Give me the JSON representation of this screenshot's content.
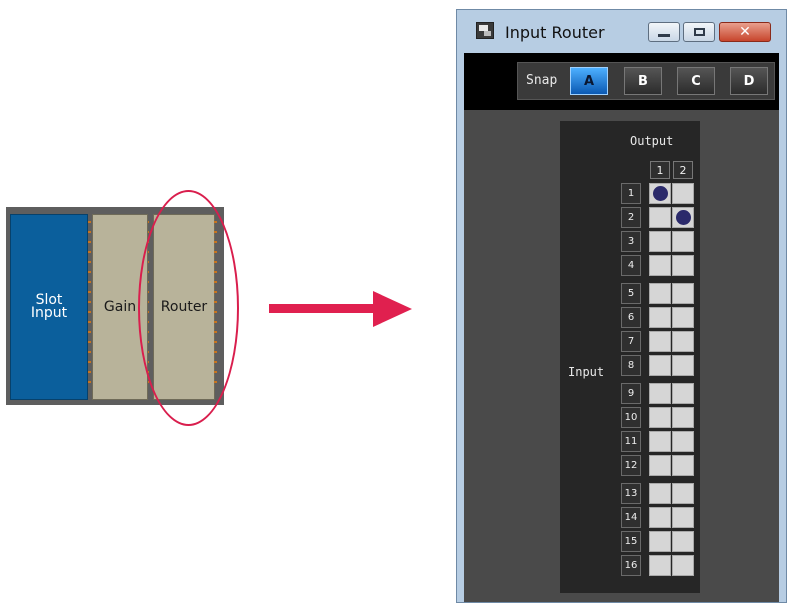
{
  "component_strip": {
    "blocks": [
      {
        "label": "Slot\nInput"
      },
      {
        "label": "Gain"
      },
      {
        "label": "Router"
      }
    ]
  },
  "window": {
    "title": "Input Router",
    "close_glyph": "✕"
  },
  "snap": {
    "label": "Snap",
    "buttons": [
      "A",
      "B",
      "C",
      "D"
    ],
    "selected": "A"
  },
  "matrix": {
    "output_label": "Output",
    "input_label": "Input",
    "outputs": [
      "1",
      "2"
    ],
    "inputs": [
      "1",
      "2",
      "3",
      "4",
      "5",
      "6",
      "7",
      "8",
      "9",
      "10",
      "11",
      "12",
      "13",
      "14",
      "15",
      "16"
    ],
    "connections": [
      [
        1,
        1
      ],
      [
        2,
        2
      ]
    ]
  },
  "colors": {
    "highlight": "#d91e4d",
    "connection_dot": "#2b2a6b",
    "snap_active": "#1e7fd8"
  },
  "icons": [
    "app-icon",
    "minimize-icon",
    "maximize-icon",
    "close-icon",
    "arrow-right-icon"
  ]
}
